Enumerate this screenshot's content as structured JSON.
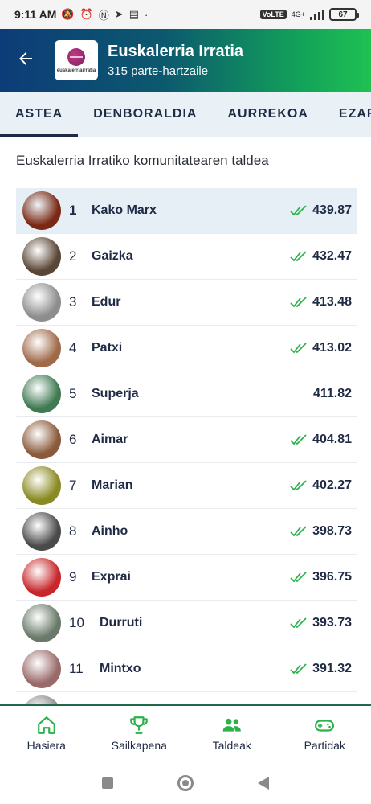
{
  "status": {
    "time": "9:11 AM",
    "battery": "67",
    "network_label": "VoLTE",
    "network_gen": "4G+"
  },
  "header": {
    "title": "Euskalerria Irratia",
    "subtitle": "315 parte-hartzaile",
    "logo_text": "euskalerriairratia"
  },
  "tabs": [
    {
      "label": "ASTEA",
      "active": true
    },
    {
      "label": "DENBORALDIA",
      "active": false
    },
    {
      "label": "AURREKOA",
      "active": false
    },
    {
      "label": "EZARPE",
      "active": false
    }
  ],
  "group_title": "Euskalerria Irratiko komunitatearen taldea",
  "ranking": [
    {
      "rank": "1",
      "name": "Kako Marx",
      "score": "439.87",
      "checked": true,
      "current_user": true,
      "avatar": "#7a2a14"
    },
    {
      "rank": "2",
      "name": "Gaizka",
      "score": "432.47",
      "checked": true,
      "current_user": false,
      "avatar": "#5a4636"
    },
    {
      "rank": "3",
      "name": "Edur",
      "score": "413.48",
      "checked": true,
      "current_user": false,
      "avatar": "#8d8d8d"
    },
    {
      "rank": "4",
      "name": "Patxi",
      "score": "413.02",
      "checked": true,
      "current_user": false,
      "avatar": "#a06a4a"
    },
    {
      "rank": "5",
      "name": "Superja",
      "score": "411.82",
      "checked": false,
      "current_user": false,
      "avatar": "#3f7a52"
    },
    {
      "rank": "6",
      "name": "Aimar",
      "score": "404.81",
      "checked": true,
      "current_user": false,
      "avatar": "#8a5a3a"
    },
    {
      "rank": "7",
      "name": "Marian",
      "score": "402.27",
      "checked": true,
      "current_user": false,
      "avatar": "#8a8a24"
    },
    {
      "rank": "8",
      "name": "Ainho",
      "score": "398.73",
      "checked": true,
      "current_user": false,
      "avatar": "#4a4a4a"
    },
    {
      "rank": "9",
      "name": "Exprai",
      "score": "396.75",
      "checked": true,
      "current_user": false,
      "avatar": "#c8262a"
    },
    {
      "rank": "10",
      "name": "Durruti",
      "score": "393.73",
      "checked": true,
      "current_user": false,
      "avatar": "#6a7a6a"
    },
    {
      "rank": "11",
      "name": "Mintxo",
      "score": "391.32",
      "checked": true,
      "current_user": false,
      "avatar": "#9a6a6a"
    },
    {
      "rank": "",
      "name": "",
      "score": "",
      "checked": false,
      "current_user": false,
      "avatar": "#8a8a8a"
    }
  ],
  "bottom_nav": [
    {
      "label": "Hasiera",
      "icon": "home-icon"
    },
    {
      "label": "Sailkapena",
      "icon": "trophy-icon"
    },
    {
      "label": "Taldeak",
      "icon": "group-icon"
    },
    {
      "label": "Partidak",
      "icon": "gamepad-icon"
    }
  ],
  "colors": {
    "accent_green": "#1fc152",
    "check_green": "#2bb24c",
    "header_blue": "#0d3c78",
    "text_dark": "#1f2a44"
  }
}
